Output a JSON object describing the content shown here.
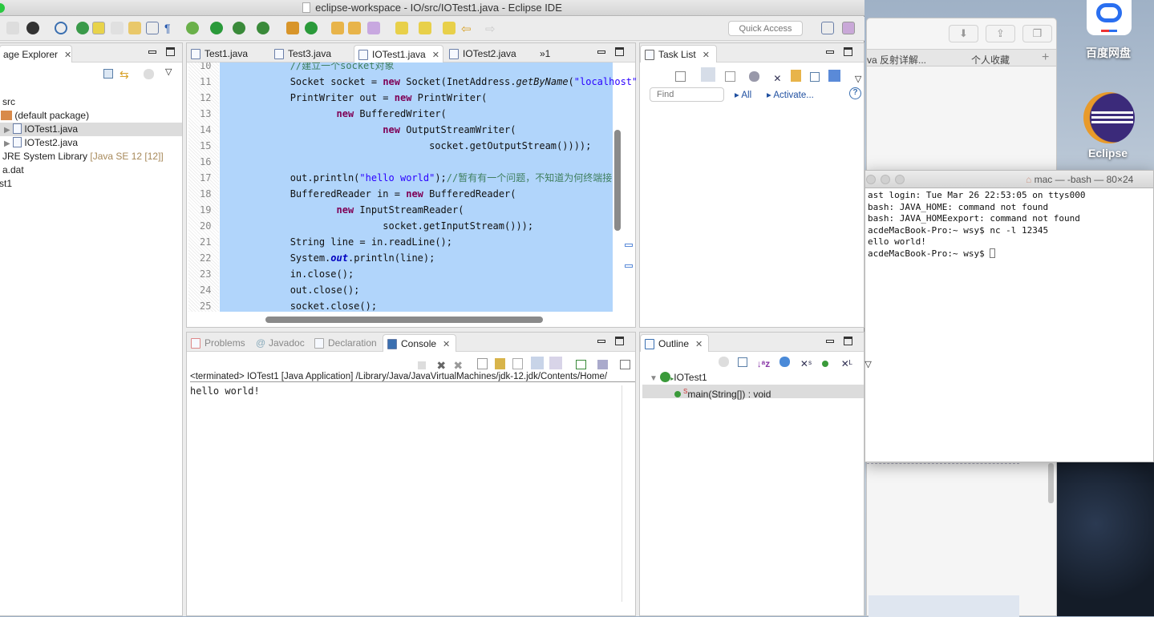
{
  "window": {
    "title": "eclipse-workspace - IO/src/IOTest1.java - Eclipse IDE"
  },
  "toolbar": {
    "quick_access_placeholder": "Quick Access"
  },
  "package_explorer": {
    "tab": "age Explorer",
    "items": [
      {
        "label": "src",
        "note": ""
      },
      {
        "label": "(default package)",
        "note": ""
      },
      {
        "label": "IOTest1.java",
        "note": "",
        "selected": true
      },
      {
        "label": "IOTest2.java",
        "note": ""
      },
      {
        "label": "JRE System Library",
        "note": "[Java SE 12 [12]]"
      },
      {
        "label": "a.dat",
        "note": ""
      },
      {
        "label": "st1",
        "note": ""
      }
    ]
  },
  "editor": {
    "tabs": [
      {
        "label": "Test1.java"
      },
      {
        "label": "Test3.java"
      },
      {
        "label": "IOTest1.java",
        "active": true
      },
      {
        "label": "IOTest2.java"
      }
    ],
    "overflow": "»1",
    "lines": [
      {
        "n": "10",
        "tokens": [
          [
            "            ",
            ""
          ],
          [
            "//建立一个socket对象",
            "cm"
          ]
        ]
      },
      {
        "n": "11",
        "tokens": [
          [
            "            Socket ",
            ""
          ],
          [
            "socket",
            ""
          ],
          [
            " = ",
            ""
          ],
          [
            "new",
            "kw"
          ],
          [
            " Socket(InetAddress.",
            ""
          ],
          [
            "getByName",
            "it"
          ],
          [
            "(",
            ""
          ],
          [
            "\"localhost\"",
            "str"
          ]
        ]
      },
      {
        "n": "12",
        "tokens": [
          [
            "            PrintWriter ",
            ""
          ],
          [
            "out",
            ""
          ],
          [
            " = ",
            ""
          ],
          [
            "new",
            "kw"
          ],
          [
            " PrintWriter(",
            ""
          ]
        ]
      },
      {
        "n": "13",
        "tokens": [
          [
            "                    ",
            ""
          ],
          [
            "new",
            "kw"
          ],
          [
            " BufferedWriter(",
            ""
          ]
        ]
      },
      {
        "n": "14",
        "tokens": [
          [
            "                            ",
            ""
          ],
          [
            "new",
            "kw"
          ],
          [
            " OutputStreamWriter(",
            ""
          ]
        ]
      },
      {
        "n": "15",
        "tokens": [
          [
            "                                    socket.getOutputStream())));",
            ""
          ]
        ]
      },
      {
        "n": "16",
        "tokens": []
      },
      {
        "n": "17",
        "tokens": [
          [
            "            out.println(",
            ""
          ],
          [
            "\"hello world\"",
            "str"
          ],
          [
            ");",
            ""
          ],
          [
            "//暂有有一个问题，不知道为何终端接",
            "cm"
          ]
        ]
      },
      {
        "n": "18",
        "tokens": [
          [
            "            BufferedReader ",
            ""
          ],
          [
            "in",
            ""
          ],
          [
            " = ",
            ""
          ],
          [
            "new",
            "kw"
          ],
          [
            " BufferedReader(",
            ""
          ]
        ]
      },
      {
        "n": "19",
        "tokens": [
          [
            "                    ",
            ""
          ],
          [
            "new",
            "kw"
          ],
          [
            " InputStreamReader(",
            ""
          ]
        ]
      },
      {
        "n": "20",
        "tokens": [
          [
            "                            socket.getInputStream()));",
            ""
          ]
        ]
      },
      {
        "n": "21",
        "tokens": [
          [
            "            String ",
            ""
          ],
          [
            "line",
            ""
          ],
          [
            " = in.readLine();",
            ""
          ]
        ]
      },
      {
        "n": "22",
        "tokens": [
          [
            "            System.",
            ""
          ],
          [
            "out",
            "sfld"
          ],
          [
            ".println(line);",
            ""
          ]
        ]
      },
      {
        "n": "23",
        "tokens": [
          [
            "            in.close();",
            ""
          ]
        ]
      },
      {
        "n": "24",
        "tokens": [
          [
            "            out.close();",
            ""
          ]
        ]
      },
      {
        "n": "25",
        "tokens": [
          [
            "            socket.close();",
            ""
          ]
        ]
      }
    ]
  },
  "console": {
    "tabs": [
      {
        "label": "Problems"
      },
      {
        "label": "Javadoc"
      },
      {
        "label": "Declaration"
      },
      {
        "label": "Console",
        "active": true
      }
    ],
    "status": "<terminated> IOTest1 [Java Application] /Library/Java/JavaVirtualMachines/jdk-12.jdk/Contents/Home/",
    "output": "hello world!"
  },
  "task_list": {
    "tab": "Task List",
    "find_placeholder": "Find",
    "all": "All",
    "activate": "Activate..."
  },
  "outline": {
    "tab": "Outline",
    "class": "IOTest1",
    "method": "main(String[]) : void",
    "static_marker": "S"
  },
  "terminal": {
    "title": "mac — -bash — 80×24",
    "lines": [
      "ast login: Tue Mar 26 22:53:05 on ttys000",
      "bash: JAVA_HOME: command not found",
      "bash: JAVA_HOMEexport: command not found",
      "acdeMacBook-Pro:~ wsy$ nc -l 12345",
      "ello world!",
      "acdeMacBook-Pro:~ wsy$ "
    ]
  },
  "browser": {
    "bookmarks": [
      "va 反射详解...",
      "个人收藏"
    ],
    "add": "+"
  },
  "desktop": {
    "icons": [
      {
        "label": "百度网盘"
      },
      {
        "label": "Eclipse"
      }
    ]
  },
  "colors": {
    "selection": "#b1d5fb",
    "keyword": "#7f0055",
    "string": "#2a00ff",
    "comment": "#3f7f5f",
    "link": "#1f4fa0"
  }
}
